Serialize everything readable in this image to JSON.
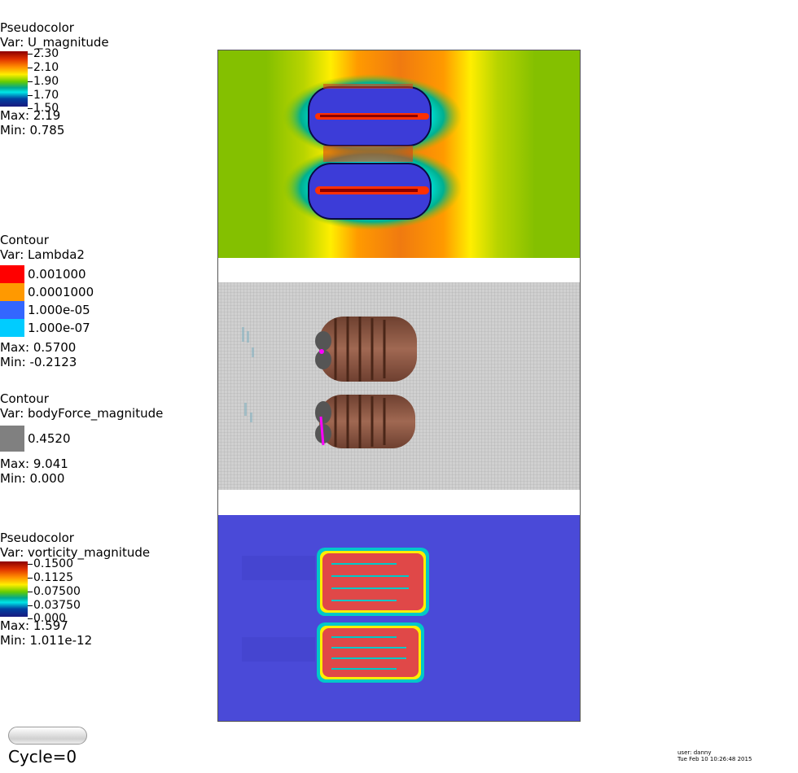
{
  "legends": {
    "u_magnitude": {
      "title": "Pseudocolor",
      "var": "Var: U_magnitude",
      "ticks": [
        "2.30",
        "2.10",
        "1.90",
        "1.70",
        "1.50"
      ],
      "max": "Max:  2.19",
      "min": "Min:  0.785"
    },
    "lambda2": {
      "title": "Contour",
      "var": "Var: Lambda2",
      "levels": [
        {
          "label": "0.001000",
          "color": "#ff0000"
        },
        {
          "label": "0.0001000",
          "color": "#ff9900"
        },
        {
          "label": "1.000e-05",
          "color": "#3366ff"
        },
        {
          "label": "1.000e-07",
          "color": "#00ccff"
        }
      ],
      "max": "Max:  0.5700",
      "min": "Min: -0.2123"
    },
    "bodyforce": {
      "title": "Contour",
      "var": "Var: bodyForce_magnitude",
      "levels": [
        {
          "label": "0.4520",
          "color": "#808080"
        }
      ],
      "max": "Max:  9.041",
      "min": "Min:  0.000"
    },
    "vorticity": {
      "title": "Pseudocolor",
      "var": "Var: vorticity_magnitude",
      "ticks": [
        "0.1500",
        "0.1125",
        "0.07500",
        "0.03750",
        "0.000"
      ],
      "max": "Max:  1.597",
      "min": "Min:  1.011e-12"
    }
  },
  "colors": {
    "field_green": "#84c000",
    "vort_blue": "#4a4ad8",
    "mesh_gray": "#c8c8c8",
    "body_brown": "#8a5a48"
  },
  "footer": {
    "cycle": "Cycle=0",
    "user": "user: danny",
    "date": "Tue Feb 10 10:26:48 2015"
  }
}
